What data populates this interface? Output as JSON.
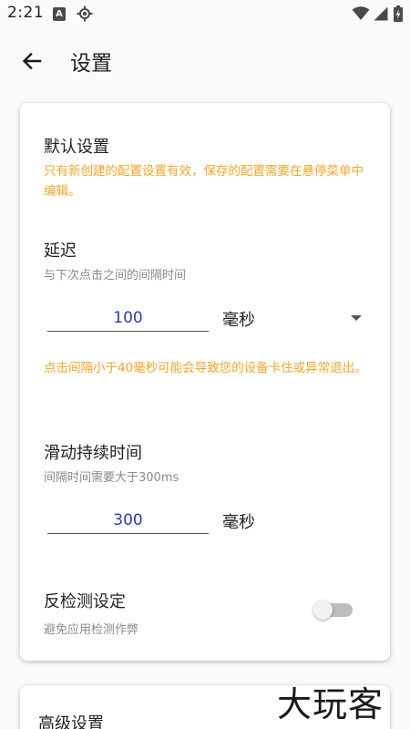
{
  "status_bar": {
    "time": "2:21",
    "notification_badge": "A"
  },
  "header": {
    "title": "设置"
  },
  "default_settings": {
    "title": "默认设置",
    "notice": "只有新创建的配置设置有效，保存的配置需要在悬停菜单中编辑。"
  },
  "delay": {
    "title": "延迟",
    "description": "与下次点击之间的间隔时间",
    "value": "100",
    "unit": "毫秒",
    "warning": "点击间隔小于40毫秒可能会导致您的设备卡住或异常退出。"
  },
  "swipe_duration": {
    "title": "滑动持续时间",
    "description": "间隔时间需要大于300ms",
    "value": "300",
    "unit": "毫秒"
  },
  "anti_detection": {
    "title": "反检测设定",
    "description": "避免应用检测作弊",
    "enabled": false
  },
  "advanced_settings": {
    "title": "高级设置"
  },
  "watermark": {
    "text": "大玩客"
  },
  "colors": {
    "accent_input": "#2f36c9",
    "warning": "#f5a623"
  }
}
